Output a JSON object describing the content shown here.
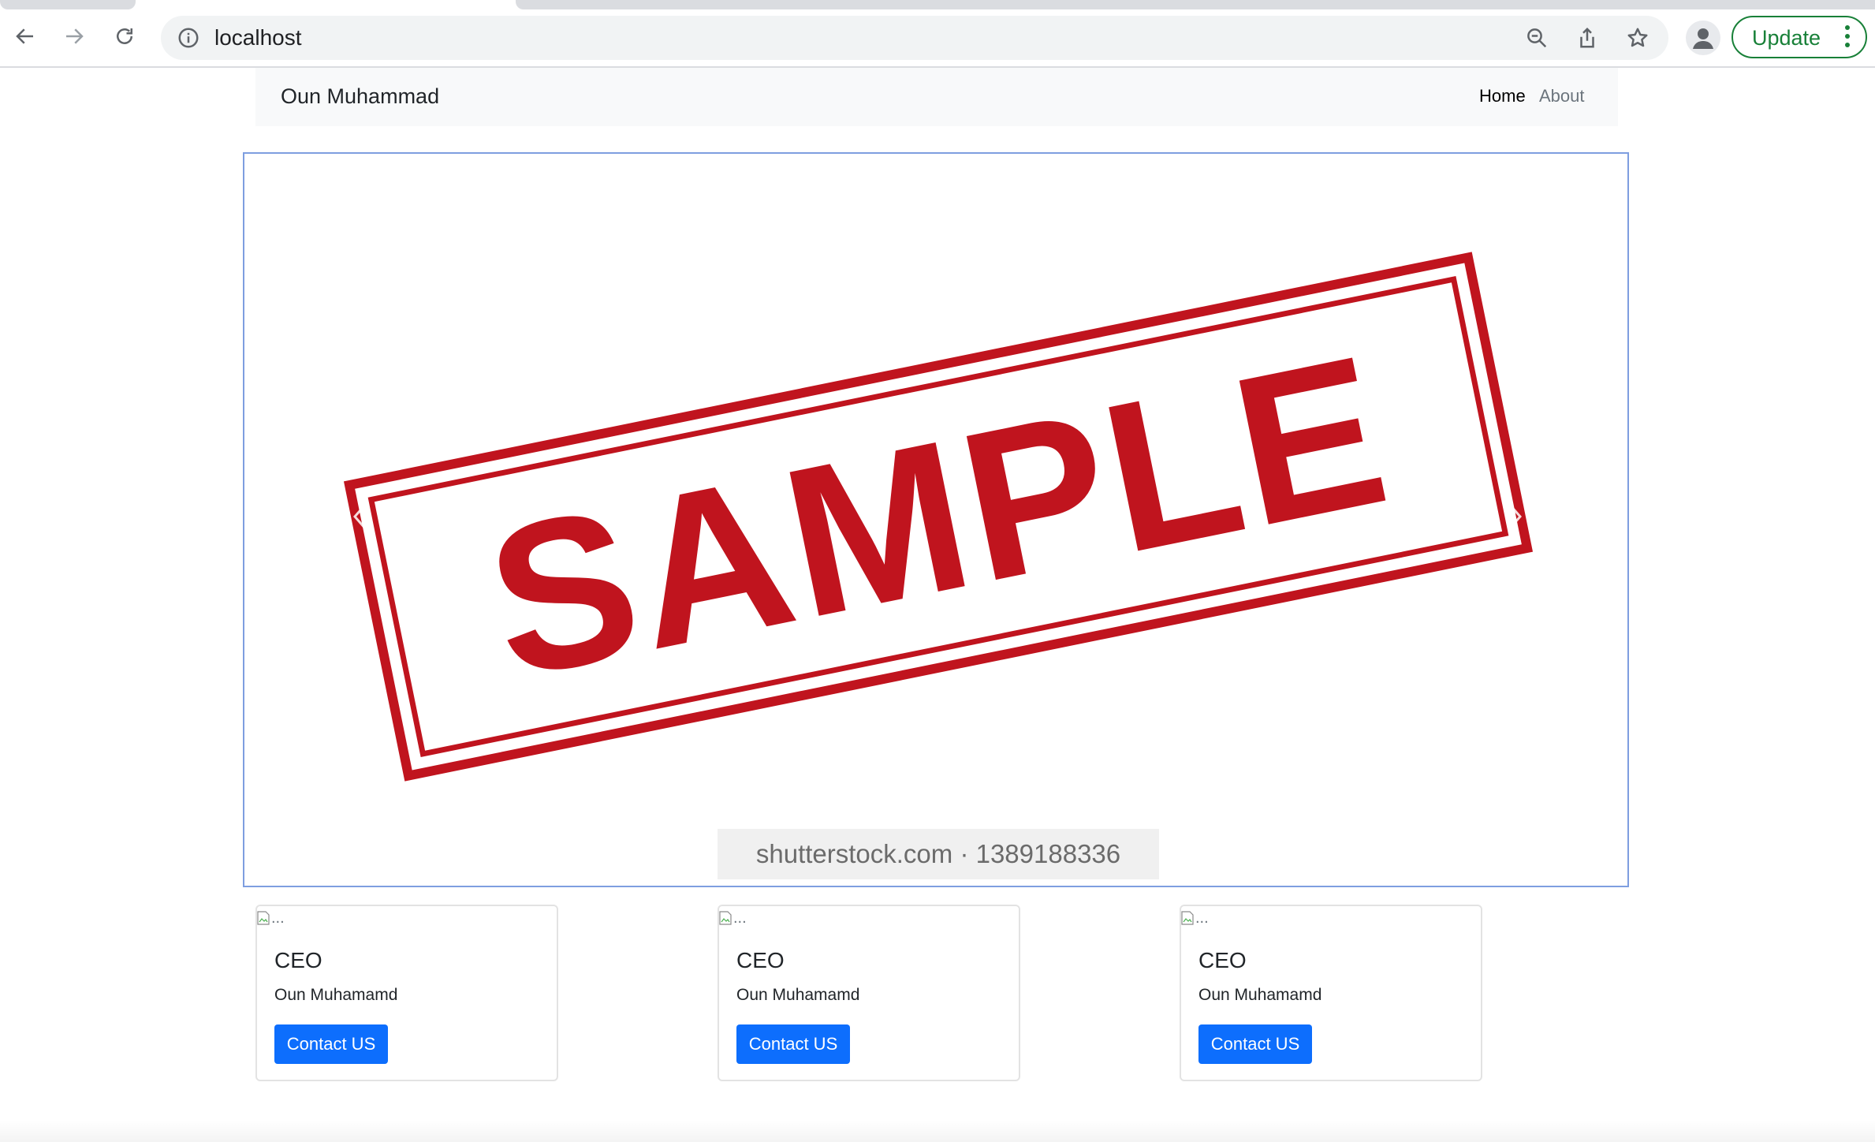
{
  "browser": {
    "url": "localhost",
    "update_label": "Update",
    "icons": [
      "back-icon",
      "forward-icon",
      "reload-icon",
      "info-icon",
      "zoom-icon",
      "share-icon",
      "star-icon",
      "profile-icon",
      "kebab-menu-icon"
    ],
    "accent_color": "#188038"
  },
  "navbar": {
    "brand": "Oun Muhammad",
    "links": [
      {
        "label": "Home",
        "active": true
      },
      {
        "label": "About",
        "active": false
      }
    ]
  },
  "carousel": {
    "slide_text": "SAMPLE",
    "watermark": "shutterstock.com · 1389188336",
    "stamp_color": "#c0141e"
  },
  "cards": [
    {
      "img_alt": "...",
      "title": "CEO",
      "text": "Oun Muhamamd",
      "button": "Contact US"
    },
    {
      "img_alt": "...",
      "title": "CEO",
      "text": "Oun Muhamamd",
      "button": "Contact US"
    },
    {
      "img_alt": "...",
      "title": "CEO",
      "text": "Oun Muhamamd",
      "button": "Contact US"
    }
  ],
  "colors": {
    "primary_button": "#0d6efd",
    "navbar_bg": "#f8f9fa"
  }
}
